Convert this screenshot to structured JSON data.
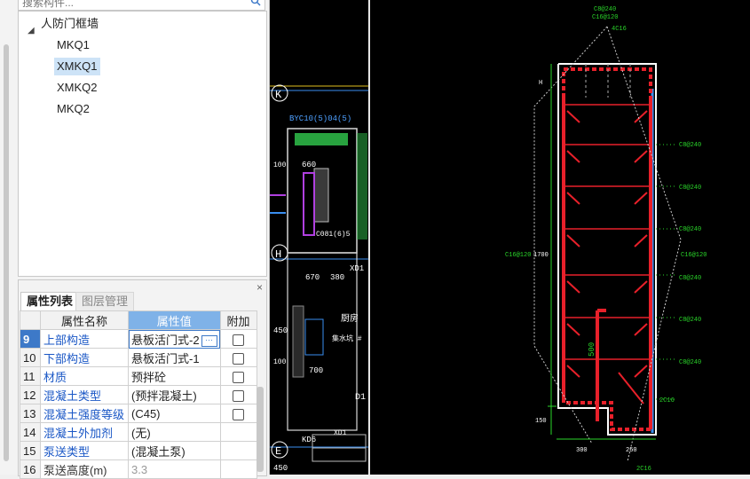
{
  "search": {
    "placeholder": "搜索构件..."
  },
  "tree": {
    "root": "人防门框墙",
    "items": [
      {
        "label": "MKQ1",
        "selected": false
      },
      {
        "label": "XMKQ1",
        "selected": true
      },
      {
        "label": "XMKQ2",
        "selected": false
      },
      {
        "label": "MKQ2",
        "selected": false
      }
    ]
  },
  "panel": {
    "tabs": [
      "属性列表",
      "图层管理"
    ],
    "close": "×",
    "headers": {
      "name": "属性名称",
      "value": "属性值",
      "add": "附加"
    },
    "rows": [
      {
        "num": "9",
        "name": "上部构造",
        "value": "悬板活门式-2",
        "checkbox": true,
        "selected": true
      },
      {
        "num": "10",
        "name": "下部构造",
        "value": "悬板活门式-1",
        "checkbox": true
      },
      {
        "num": "11",
        "name": "材质",
        "value": "预拌砼",
        "checkbox": true
      },
      {
        "num": "12",
        "name": "混凝土类型",
        "value": "(预拌混凝土)",
        "checkbox": true
      },
      {
        "num": "13",
        "name": "混凝土强度等级",
        "value": "(C45)",
        "checkbox": true
      },
      {
        "num": "14",
        "name": "混凝土外加剂",
        "value": "(无)",
        "checkbox": false
      },
      {
        "num": "15",
        "name": "泵送类型",
        "value": "(混凝土泵)",
        "checkbox": false
      },
      {
        "num": "16",
        "name": "泵送高度(m)",
        "value": "3.3",
        "checkbox": false,
        "gray": true
      }
    ]
  },
  "cad_left": {
    "labels": [
      "K",
      "BYC10(5)04(5)",
      "660",
      "100",
      "C081(6)5",
      "H",
      "XD1",
      "670",
      "380",
      "450",
      "厨房",
      "集水坑 #",
      "700",
      "100",
      "D1",
      "XD1",
      "KD6",
      "E",
      "450"
    ]
  },
  "cad_right": {
    "labels": [
      "C8@240",
      "C16@120",
      "4C16",
      "H",
      "C8@240",
      "C8@240",
      "C8@240",
      "C16@120",
      "1700",
      "C16@120",
      "C8@240",
      "C8@240",
      "C8@240",
      "500",
      "150",
      "2C16",
      "300",
      "250",
      "2C16"
    ]
  },
  "colors": {
    "accent": "#3d79c8",
    "rebar": "#e8202a",
    "dim": "#2ad62a",
    "wall": "#ffffff",
    "blue": "#3a8ef0"
  }
}
